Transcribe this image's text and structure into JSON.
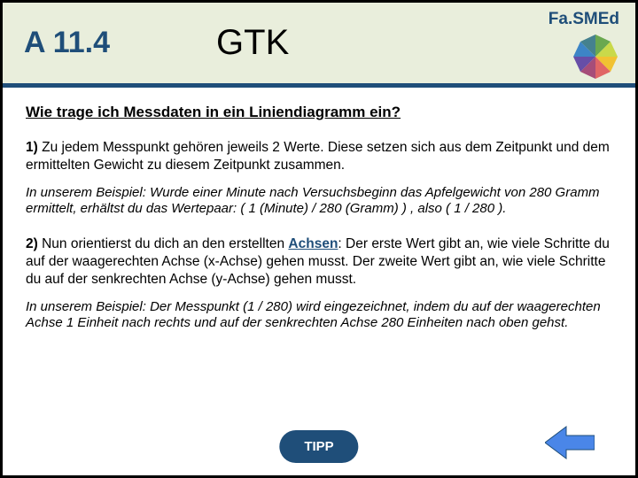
{
  "header": {
    "code": "A 11.4",
    "title": "GTK",
    "brand": "Fa.SMEd"
  },
  "question": "Wie trage ich Messdaten in ein Liniendiagramm ein?",
  "p1_lead": "1)",
  "p1_text": " Zu jedem Messpunkt gehören jeweils 2 Werte. Diese setzen sich aus dem Zeitpunkt und dem ermittelten Gewicht zu diesem Zeitpunkt zusammen.",
  "p1_example": "In unserem Beispiel: Wurde einer Minute nach Versuchsbeginn das Apfelgewicht von 280 Gramm ermittelt, erhältst du das Wertepaar: ( 1 (Minute)  /  280 (Gramm) ) , also ( 1 / 280 ).",
  "p2_lead": "2)",
  "p2_a": " Nun orientierst du dich an den erstellten ",
  "p2_link": "Achsen",
  "p2_b": ": Der erste Wert gibt an, wie viele Schritte du auf der waagerechten Achse (x-Achse) gehen musst. Der zweite Wert gibt an, wie viele Schritte du auf der senkrechten Achse (y-Achse) gehen musst.",
  "p2_example": "In unserem Beispiel: Der Messpunkt (1 /  280) wird eingezeichnet, indem du auf der waagerechten Achse 1 Einheit nach rechts und auf der senkrechten Achse 280 Einheiten nach oben gehst.",
  "tipp": "TIPP"
}
